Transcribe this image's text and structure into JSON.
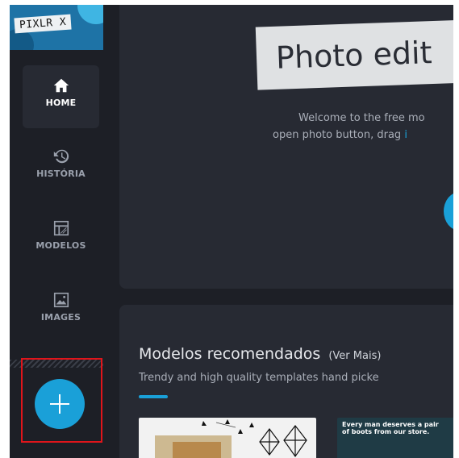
{
  "app": {
    "logo_text": "PIXLR X"
  },
  "sidebar": {
    "items": [
      {
        "label": "HOME",
        "icon": "home-icon",
        "active": true
      },
      {
        "label": "HISTÓRIA",
        "icon": "history-icon",
        "active": false
      },
      {
        "label": "MODELOS",
        "icon": "templates-icon",
        "active": false
      },
      {
        "label": "IMAGES",
        "icon": "image-icon",
        "active": false
      }
    ],
    "add_button_icon": "plus-icon"
  },
  "hero": {
    "title": "Photo edit",
    "line1": "Welcome to the free mo",
    "line2_plain": "open photo button, drag",
    "line2_highlight": "i"
  },
  "templates": {
    "title": "Modelos recomendados",
    "more_link": "(Ver Mais)",
    "subtitle": "Trendy and high quality templates hand picke",
    "card2_text": "Every man deserves a pair of boots from our store."
  },
  "colors": {
    "accent": "#1aa0d8",
    "background": "#1d1f26",
    "panel": "#272a33",
    "highlight_border": "#e0151b"
  }
}
